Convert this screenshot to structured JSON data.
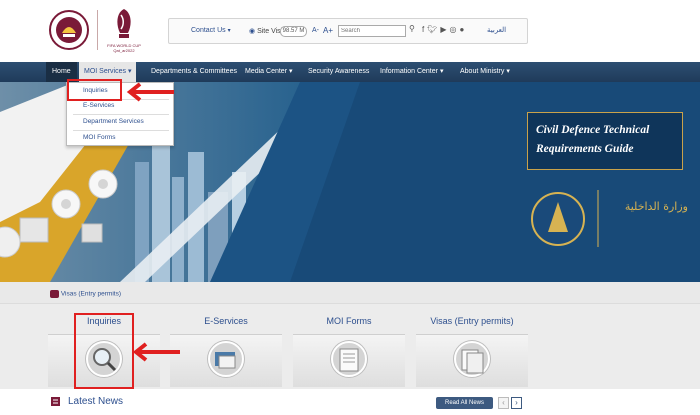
{
  "header": {
    "wc_logo_text": "FIFA WORLD CUP Qat_ar2022",
    "moi_logo_text": "STATE OF QATAR MINISTRY OF INTERIOR"
  },
  "topbar": {
    "contact_label": "Contact Us",
    "site_visits_label": "Site Visits",
    "site_visits_count": "98.57 M",
    "font_decrease": "A-",
    "font_increase": "A+",
    "search_placeholder": "Search",
    "social_icons": [
      "facebook-icon",
      "twitter-icon",
      "youtube-icon",
      "instagram-icon",
      "snapchat-icon"
    ],
    "language_label": "العربية"
  },
  "nav": {
    "items": [
      {
        "label": "Home"
      },
      {
        "label": "MOI Services"
      },
      {
        "label": "Departments & Committees"
      },
      {
        "label": "Media Center"
      },
      {
        "label": "Security Awareness"
      },
      {
        "label": "Information Center"
      },
      {
        "label": "About Ministry"
      }
    ]
  },
  "dropdown": {
    "items": [
      {
        "label": "Inquiries"
      },
      {
        "label": "E-Services"
      },
      {
        "label": "Department Services"
      },
      {
        "label": "MOI Forms"
      }
    ]
  },
  "hero": {
    "title_line1": "Civil Defence Technical",
    "title_line2": "Requirements Guide",
    "arabic_logo_text": "وزارة الداخلية"
  },
  "breadcrumb": {
    "label": "Visas (Entry permits)"
  },
  "services": {
    "tiles": [
      {
        "label": "Inquiries",
        "icon": "magnifier-icon"
      },
      {
        "label": "E-Services",
        "icon": "eservices-icon"
      },
      {
        "label": "MOI Forms",
        "icon": "forms-icon"
      },
      {
        "label": "Visas (Entry permits)",
        "icon": "visa-icon"
      }
    ]
  },
  "news": {
    "title": "Latest News",
    "read_all_label": "Read All News",
    "prev": "‹",
    "next": "›"
  },
  "colors": {
    "nav_bg": "#2d4f72",
    "link_blue": "#2d4f8e",
    "annotation_red": "#e02020",
    "hero_gold": "#c9a24a"
  }
}
